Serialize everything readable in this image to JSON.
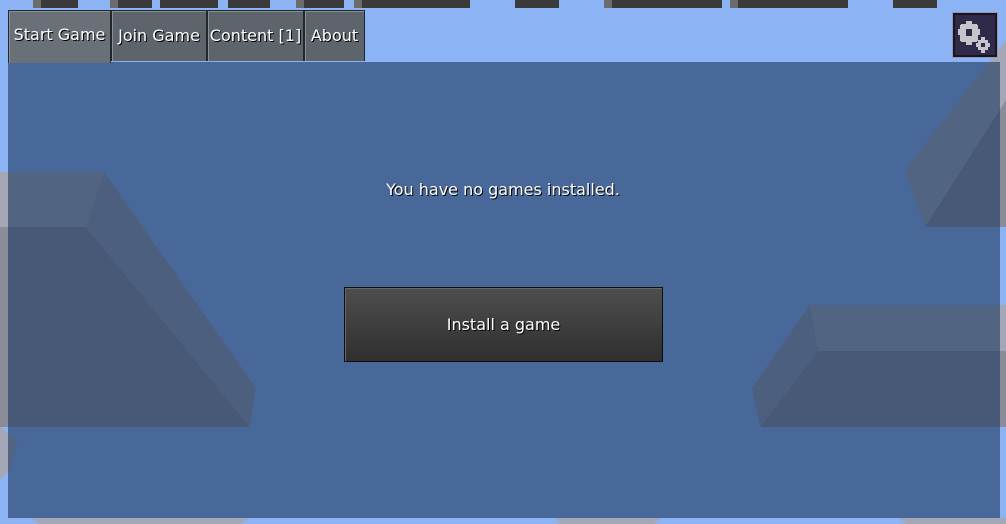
{
  "tabs": [
    {
      "label": "Start Game",
      "active": true
    },
    {
      "label": "Join Game",
      "active": false
    },
    {
      "label": "Content [1]",
      "active": false
    },
    {
      "label": "About",
      "active": false
    }
  ],
  "main": {
    "message": "You have no games installed.",
    "install_button_label": "Install a game"
  },
  "settings": {
    "icon": "gears-icon"
  },
  "colors": {
    "sky": "#8cb4f5",
    "panel_overlay": "#3f5472",
    "tab_bg": "#5d646c",
    "button_bg": "#3c3c3c",
    "settings_bg": "#2e2a47"
  }
}
